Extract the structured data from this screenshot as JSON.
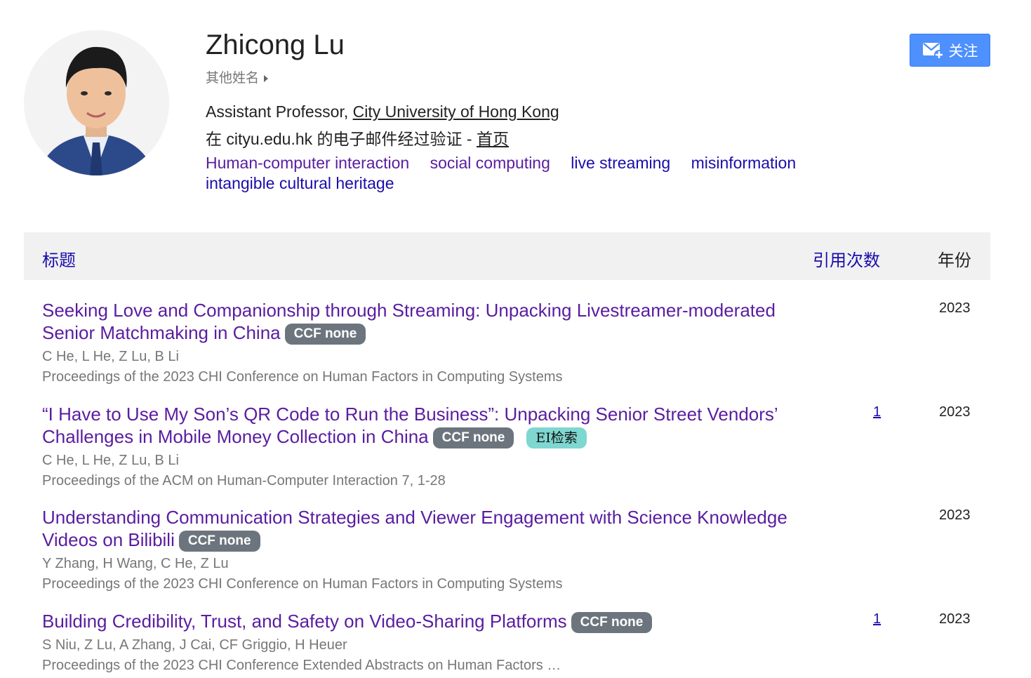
{
  "profile": {
    "name": "Zhicong Lu",
    "other_names_label": "其他姓名",
    "affiliation_prefix": "Assistant Professor, ",
    "affiliation_link": "City University of Hong Kong",
    "email_text": "在 cityu.edu.hk 的电子邮件经过验证 - ",
    "homepage_label": "首页",
    "interests": [
      "Human-computer interaction",
      "social computing",
      "live streaming",
      "misinformation",
      "intangible cultural heritage"
    ]
  },
  "follow_button": {
    "label": "关注",
    "icon": "mail-plus-icon"
  },
  "table": {
    "headers": {
      "title": "标题",
      "cited_by": "引用次数",
      "year": "年份"
    },
    "rows": [
      {
        "title": "Seeking Love and Companionship through Streaming: Unpacking Livestreamer-moderated Senior Matchmaking in China",
        "badges": [
          "CCF none"
        ],
        "authors": "C He, L He, Z Lu, B Li",
        "venue": "Proceedings of the 2023 CHI Conference on Human Factors in Computing Systems",
        "cites": "",
        "year": "2023"
      },
      {
        "title": "“I Have to Use My Son’s QR Code to Run the Business”: Unpacking Senior Street Vendors’ Challenges in Mobile Money Collection in China",
        "badges": [
          "CCF none",
          "EI检索"
        ],
        "authors": "C He, L He, Z Lu, B Li",
        "venue": "Proceedings of the ACM on Human-Computer Interaction 7, 1-28",
        "cites": "1",
        "year": "2023"
      },
      {
        "title": "Understanding Communication Strategies and Viewer Engagement with Science Knowledge Videos on Bilibili",
        "badges": [
          "CCF none"
        ],
        "authors": "Y Zhang, H Wang, C He, Z Lu",
        "venue": "Proceedings of the 2023 CHI Conference on Human Factors in Computing Systems",
        "cites": "",
        "year": "2023"
      },
      {
        "title": "Building Credibility, Trust, and Safety on Video-Sharing Platforms",
        "badges": [
          "CCF none"
        ],
        "authors": "S Niu, Z Lu, A Zhang, J Cai, CF Griggio, H Heuer",
        "venue": "Proceedings of the 2023 CHI Conference Extended Abstracts on Human Factors …",
        "cites": "1",
        "year": "2023"
      }
    ]
  },
  "colors": {
    "accent_blue": "#4d90fe",
    "link_purple": "#5a1da0",
    "link_blue": "#1a0dab",
    "badge_gray": "#6c757d",
    "badge_teal": "#7ed7d0"
  }
}
